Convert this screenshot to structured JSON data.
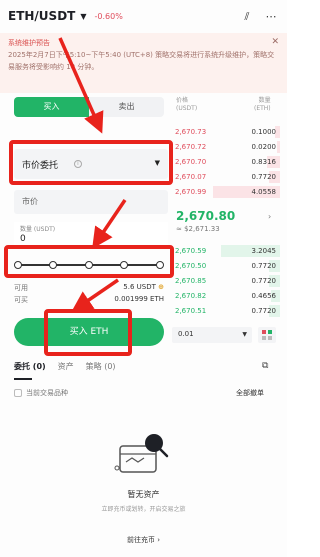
{
  "header": {
    "pair": "ETH/USDT",
    "change": "-0.60%",
    "icons": [
      "candlestick-icon",
      "more-icon"
    ]
  },
  "notice": {
    "title": "系统维护预告",
    "body": "2025年2月7日下午5:10~下午5:40 (UTC+8) 策略交易将进行系统升级维护，策略交易服务将受影响约 10 分钟。"
  },
  "trade": {
    "tab_buy": "买入",
    "tab_sell": "卖出",
    "order_type_label": "市价委托",
    "price_placeholder": "市价",
    "qty_label": "数量 (USDT)",
    "qty_value": "0",
    "available_label": "可用",
    "available_value": "5.6 USDT",
    "can_buy_label": "可买",
    "can_buy_value": "0.001999 ETH",
    "buy_button": "买入 ETH"
  },
  "orderbook": {
    "price_header": "价格\n(USDT)",
    "qty_header": "数量\n(ETH)",
    "asks": [
      {
        "price": "2,670.73",
        "qty": "0.1000",
        "depth": 0.05
      },
      {
        "price": "2,670.72",
        "qty": "0.0200",
        "depth": 0.03
      },
      {
        "price": "2,670.70",
        "qty": "0.8316",
        "depth": 0.12
      },
      {
        "price": "2,670.07",
        "qty": "0.7720",
        "depth": 0.1
      },
      {
        "price": "2,670.99",
        "qty": "4.0558",
        "depth": 0.62
      }
    ],
    "last_price": "2,670.80",
    "last_price_usd": "≈ $2,671.33",
    "bids": [
      {
        "price": "2,670.59",
        "qty": "3.2045",
        "depth": 0.55
      },
      {
        "price": "2,670.50",
        "qty": "0.7720",
        "depth": 0.1
      },
      {
        "price": "2,670.85",
        "qty": "0.7720",
        "depth": 0.1
      },
      {
        "price": "2,670.82",
        "qty": "0.4656",
        "depth": 0.08
      },
      {
        "price": "2,670.51",
        "qty": "0.7720",
        "depth": 0.1
      }
    ],
    "precision": "0.01"
  },
  "orders": {
    "tabs": [
      "委托 (0)",
      "资产",
      "策略 (0)"
    ],
    "current_only": "当前交易品种",
    "cancel_all": "全部撤单",
    "empty_title": "暂无资产",
    "empty_sub": "立即充币或划转，开启交易之旅",
    "go_deposit": "前往充币"
  },
  "slider": {
    "value": 0,
    "marks": [
      0,
      25,
      50,
      75,
      100
    ]
  },
  "colors": {
    "accent_green": "#22b467",
    "ask_red": "#e04d5c",
    "annotation_red": "#e8231c"
  }
}
